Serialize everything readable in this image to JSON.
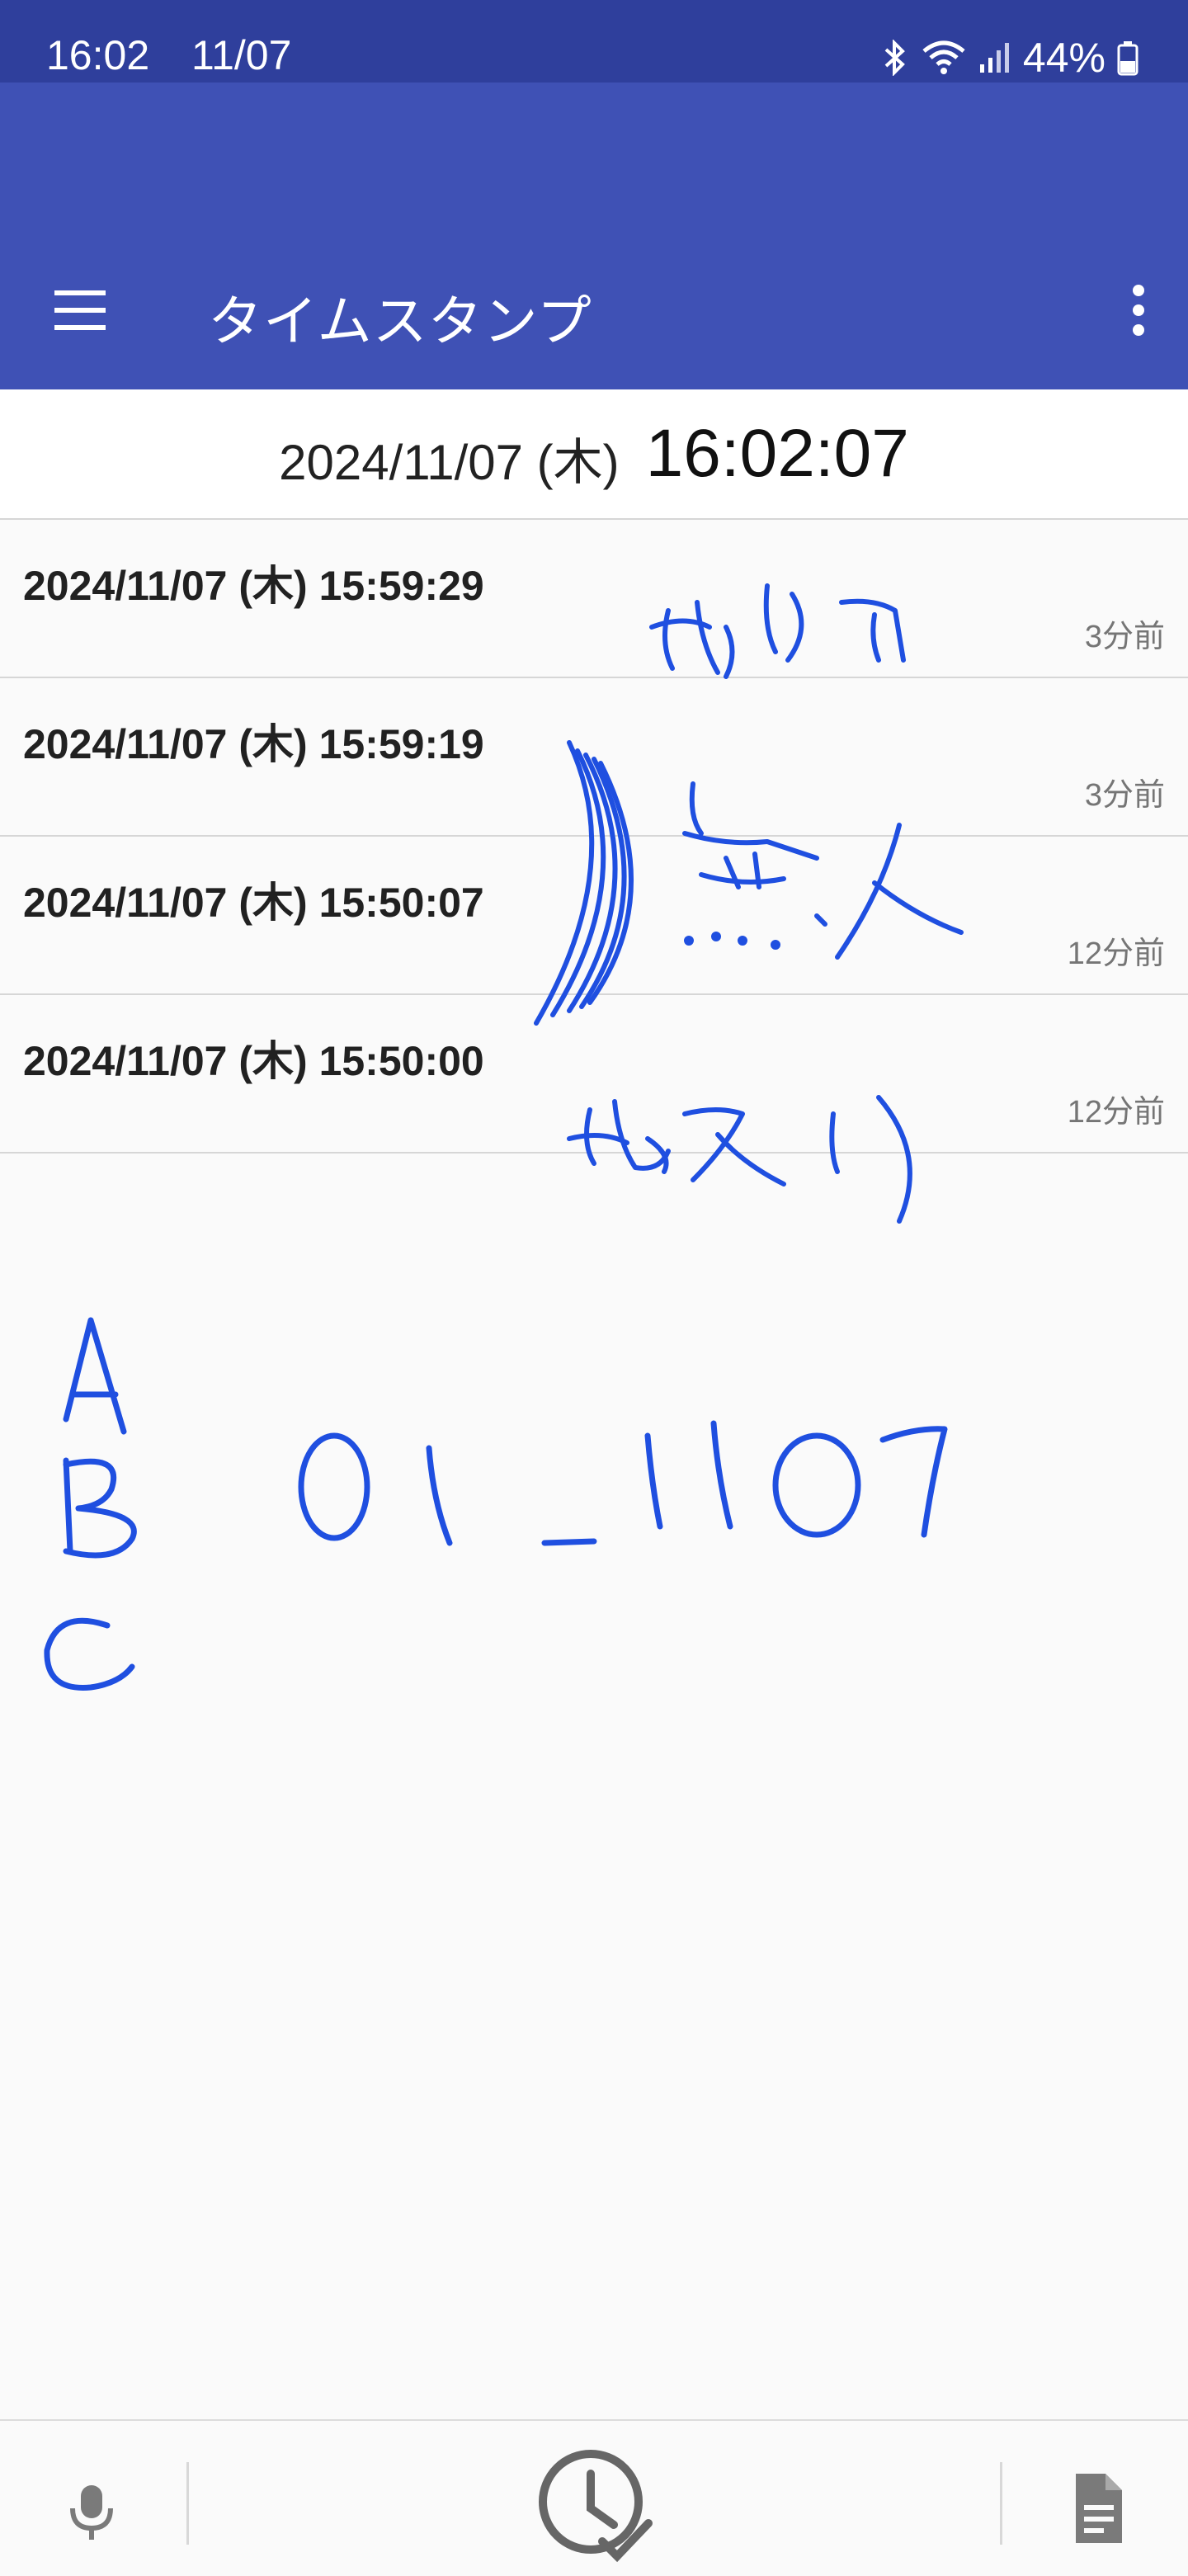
{
  "status_bar": {
    "time": "16:02",
    "date": "11/07",
    "battery": "44%",
    "icons": [
      "bluetooth-icon",
      "wifi-icon",
      "signal-icon",
      "battery-icon"
    ]
  },
  "toolbar": {
    "title": "タイムスタンプ",
    "menu_icon": "hamburger-menu-icon",
    "overflow_icon": "more-vert-icon",
    "color": "#3f51b5"
  },
  "clock": {
    "date": "2024/11/07 (木)",
    "time": "16:02:07"
  },
  "entries": [
    {
      "timestamp": "2024/11/07 (木) 15:59:29",
      "ago": "3分前"
    },
    {
      "timestamp": "2024/11/07 (木) 15:59:19",
      "ago": "3分前"
    },
    {
      "timestamp": "2024/11/07 (木) 15:50:07",
      "ago": "12分前"
    },
    {
      "timestamp": "2024/11/07 (木) 15:50:00",
      "ago": "12分前"
    }
  ],
  "handwriting": {
    "ink_color": "#1f4fe0",
    "notes": [
      "出入り",
      "無人",
      "ABC",
      "01_1107"
    ]
  },
  "bottom_bar": {
    "icons": [
      "microphone-icon",
      "timestamp-clock-check-icon",
      "document-icon"
    ]
  }
}
